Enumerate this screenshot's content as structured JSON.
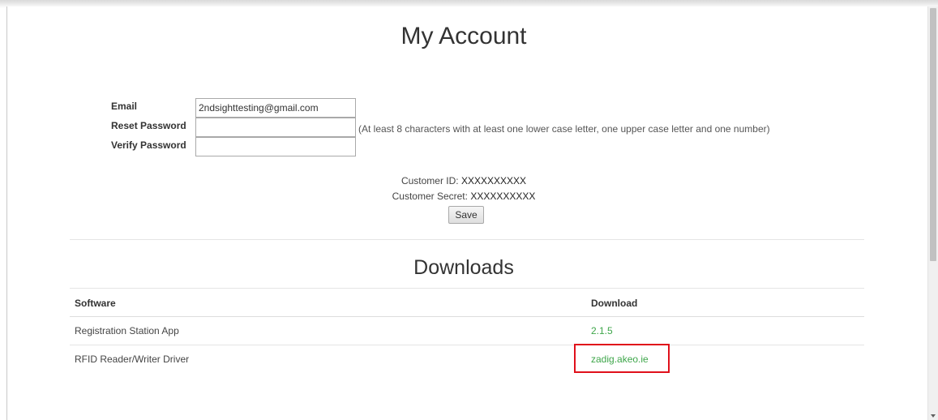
{
  "page": {
    "title": "My Account"
  },
  "form": {
    "email_label": "Email",
    "email_value": "2ndsighttesting@gmail.com",
    "reset_label": "Reset Password",
    "reset_value": "",
    "verify_label": "Verify Password",
    "verify_value": "",
    "password_hint": "(At least 8 characters with at least one lower case letter, one upper case letter and one number)"
  },
  "customer": {
    "id_label": "Customer ID:",
    "id_value": "XXXXXXXXXX",
    "secret_label": "Customer Secret:",
    "secret_value": "XXXXXXXXXX",
    "save_label": "Save"
  },
  "downloads": {
    "title": "Downloads",
    "headers": [
      "Software",
      "Download"
    ],
    "rows": [
      {
        "software": "Registration Station App",
        "download": "2.1.5"
      },
      {
        "software": "RFID Reader/Writer Driver",
        "download": "zadig.akeo.ie"
      }
    ]
  },
  "colors": {
    "link": "#3ea64a",
    "highlight": "#e0101b"
  }
}
